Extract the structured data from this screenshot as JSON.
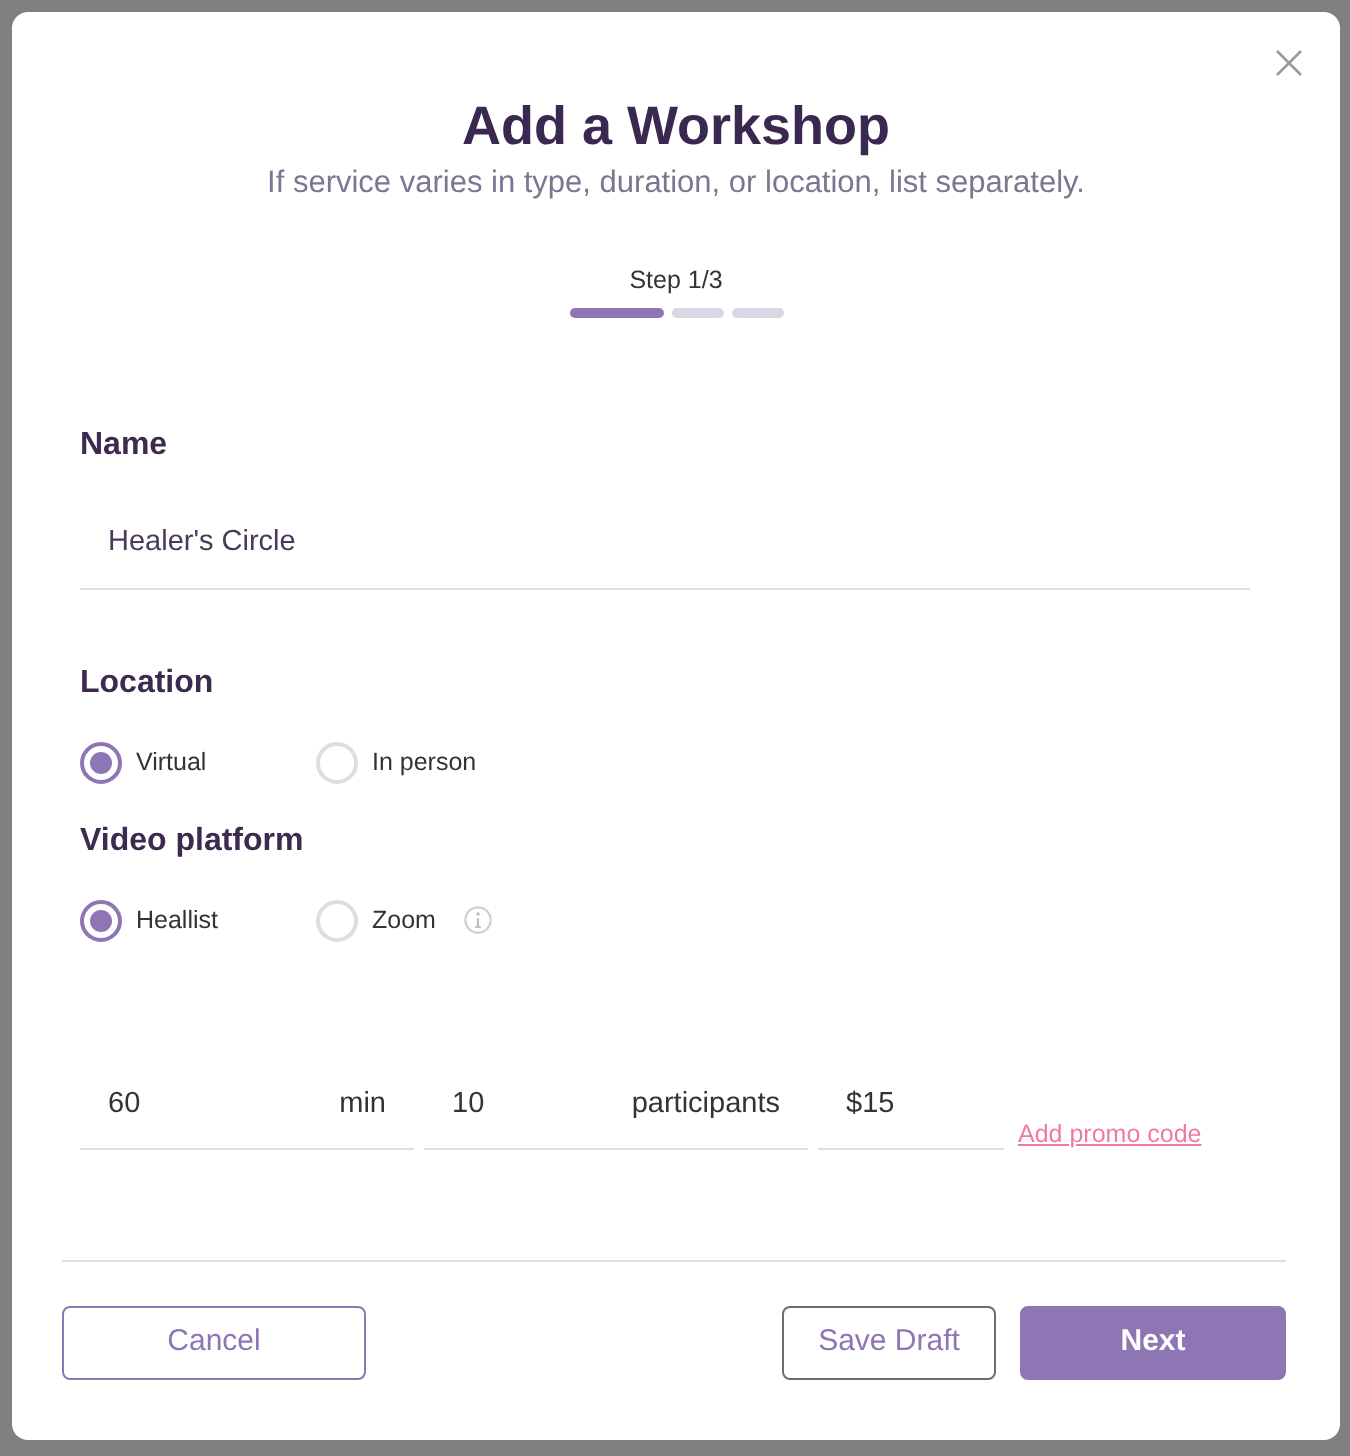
{
  "dialog": {
    "title": "Add a Workshop",
    "subtitle": "If service varies in type, duration, or location, list separately."
  },
  "stepper": {
    "label": "Step 1/3",
    "steps": [
      {
        "active": true
      },
      {
        "active": false
      },
      {
        "active": false
      }
    ]
  },
  "name_field": {
    "label": "Name",
    "value": "Healer's Circle"
  },
  "location": {
    "label": "Location",
    "options": [
      {
        "label": "Virtual",
        "selected": true
      },
      {
        "label": "In person",
        "selected": false
      }
    ]
  },
  "video_platform": {
    "label": "Video platform",
    "options": [
      {
        "label": "Heallist",
        "selected": true,
        "info": false
      },
      {
        "label": "Zoom",
        "selected": false,
        "info": true
      }
    ]
  },
  "details": [
    {
      "value": "60",
      "unit": "min"
    },
    {
      "value": "10",
      "unit": "participants"
    },
    {
      "value": "$15"
    }
  ],
  "promo_link": "Add promo code",
  "buttons": [
    {
      "label": "Cancel",
      "kind": "outline"
    },
    {
      "label": "Save Draft",
      "kind": "secondary"
    },
    {
      "label": "Next",
      "kind": "primary"
    }
  ]
}
